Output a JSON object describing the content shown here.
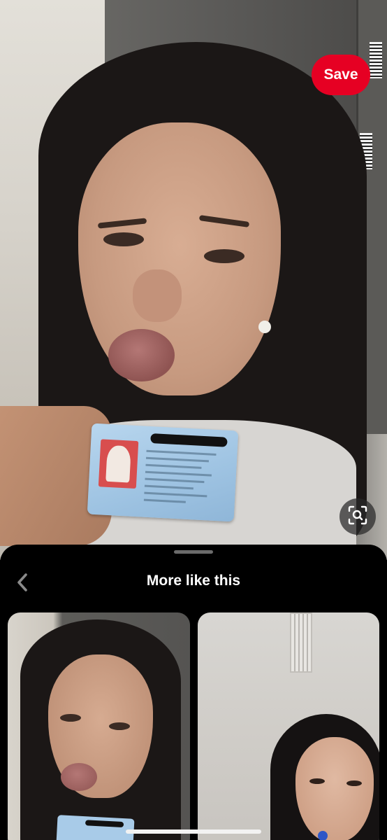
{
  "pin": {
    "save_label": "Save",
    "visual_search_icon": "search-lens-icon"
  },
  "sheet": {
    "back_icon": "chevron-left-icon",
    "title": "More like this",
    "results": [
      {
        "id": "result-1"
      },
      {
        "id": "result-2"
      }
    ]
  },
  "colors": {
    "save_red": "#e60023",
    "sheet_bg": "#000000",
    "text": "#ffffff"
  }
}
